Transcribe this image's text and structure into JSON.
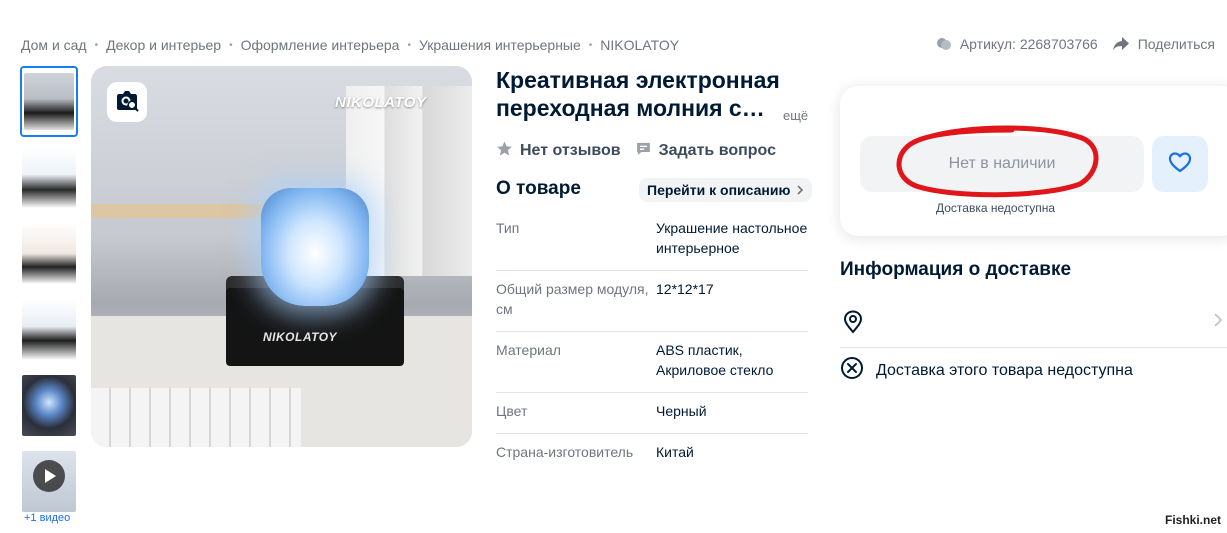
{
  "breadcrumb": [
    "Дом и сад",
    "Декор и интерьер",
    "Оформление интерьера",
    "Украшения интерьерные",
    "NIKOLATOY"
  ],
  "breadcrumb_separator": "•",
  "header": {
    "article": "Артикул: 2268703766",
    "share": "Поделиться"
  },
  "gallery": {
    "video_label": "+1 видео",
    "brand_overlay": "NIKOLATOY",
    "base_overlay": "NIKOLATOY"
  },
  "product": {
    "title_line1": "Креативная электронная",
    "title_line2": "переходная молния с…",
    "more": "ещё",
    "reviews": "Нет отзывов",
    "ask": "Задать вопрос",
    "about_title": "О товаре",
    "to_description": "Перейти к описанию",
    "specs": [
      {
        "key": "Тип",
        "value": "Украшение настольное интерьерное"
      },
      {
        "key": "Общий размер модуля, см",
        "value": "12*12*17"
      },
      {
        "key": "Материал",
        "value": "ABS пластик, Акриловое стекло"
      },
      {
        "key": "Цвет",
        "value": "Черный"
      },
      {
        "key": "Страна-изготовитель",
        "value": "Китай"
      }
    ]
  },
  "buy_card": {
    "stock_status": "Нет в наличии",
    "delivery_note": "Доставка недоступна"
  },
  "delivery": {
    "title": "Информация о доставке",
    "unavailable": "Доставка этого товара недоступна"
  },
  "watermark": "Fishki.net",
  "colors": {
    "accent": "#1a7cf2",
    "scribble": "#e0161b",
    "text_dark": "#001a34",
    "muted": "#70757e"
  }
}
